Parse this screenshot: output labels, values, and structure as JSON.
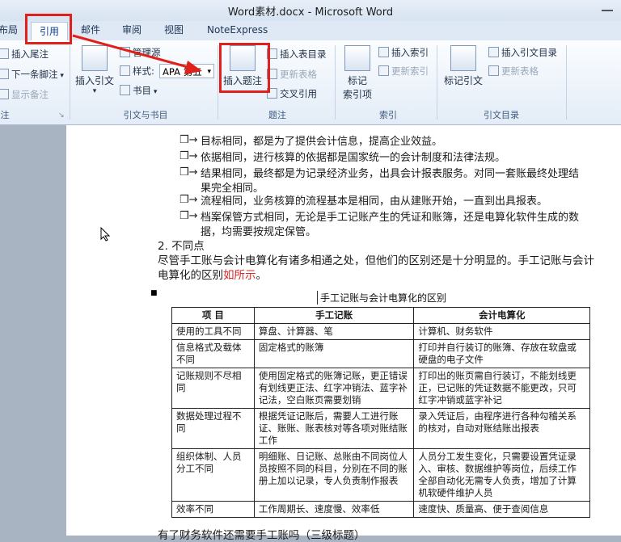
{
  "window": {
    "title": "Word素材.docx - Microsoft Word"
  },
  "tabs": [
    "布局",
    "引用",
    "邮件",
    "审阅",
    "视图",
    "NoteExpress"
  ],
  "active_tab": "引用",
  "ribbon": {
    "footnotes": {
      "insert_endnote": "插入尾注",
      "next_footnote": "下一条脚注",
      "show_notes": "显示备注",
      "label": "注"
    },
    "citations": {
      "insert_citation": "插入引文",
      "manage_sources": "管理源",
      "style_label": "样式:",
      "style_value": "APA 第五",
      "bibliography": "书目",
      "label": "引文与书目"
    },
    "captions": {
      "insert_caption": "插入题注",
      "insert_table_of_figures": "插入表目录",
      "update_table": "更新表格",
      "cross_reference": "交叉引用",
      "label": "题注"
    },
    "index": {
      "mark_entry": "标记\n索引项",
      "mark_entry_1": "标记",
      "mark_entry_2": "索引项",
      "insert_index": "插入索引",
      "update_index": "更新索引",
      "label": "索引"
    },
    "toa": {
      "mark_citation": "标记引文",
      "insert_toa": "插入引文目录",
      "update_table": "更新表格",
      "label": "引文目录"
    }
  },
  "document": {
    "bullets": [
      "目标相同，都是为了提供会计信息，提高企业效益。",
      "依据相同，进行核算的依据都是国家统一的会计制度和法律法规。",
      "结果相同，最终都是为记录经济业务，出具会计报表服务。对同一套账最终处理结",
      "果完全相同。",
      "流程相同，业务核算的流程基本是相同，由从建账开始，一直到出具报表。",
      "档案保管方式相同，无论是手工记账产生的凭证和账簿，还是电算化软件生成的数",
      "据，均需要按规定保管。"
    ],
    "heading": "2. 不同点",
    "paragraph_line1": "尽管手工账与会计电算化有诸多相通之处，但他们的区别还是十分明显的。手工记账与会计",
    "paragraph_line2_a": "电算化的区别",
    "paragraph_line2_b": "如所示",
    "paragraph_line2_c": "。",
    "caption": "手工记账与会计电算化的区别",
    "table": {
      "headers": [
        "项  目",
        "手工记账",
        "会计电算化"
      ],
      "rows": [
        [
          "使用的工具不同",
          "算盘、计算器、笔",
          "计算机、财务软件"
        ],
        [
          "信息格式及载体不同",
          "固定格式的账簿",
          "打印并自行装订的账簿、存放在软盘或硬盘的电子文件"
        ],
        [
          "记账规则不尽相同",
          "使用固定格式的账簿记账，更正错误有划线更正法、红字冲销法、蓝字补记法，空白账页需要划销",
          "打印出的账页需自行装订，不能划线更正，已记账的凭证数据不能更改，只可红字冲销或蓝字补记"
        ],
        [
          "数据处理过程不同",
          "根据凭证记账后，需要人工进行账证、账账、账表核对等各项对账结账工作",
          "录入凭证后，由程序进行各种勾稽关系的核对，自动对账结账出报表"
        ],
        [
          "组织体制、人员分工不同",
          "明细账、日记账、总账由不同岗位人员按照不同的科目，分别在不同的账册上加以记录，专人负责制作报表",
          "人员分工发生变化，只需要设置凭证录入、审核、数据维护等岗位，后续工作全部自动化无需专人负责，增加了计算机软硬件维护人员"
        ],
        [
          "效率不同",
          "工作周期长、速度慢、效率低",
          "速度快、质量高、便于查阅信息"
        ]
      ]
    },
    "bottom_text": "有了财务软件还需要手工账吗（三级标题）"
  }
}
